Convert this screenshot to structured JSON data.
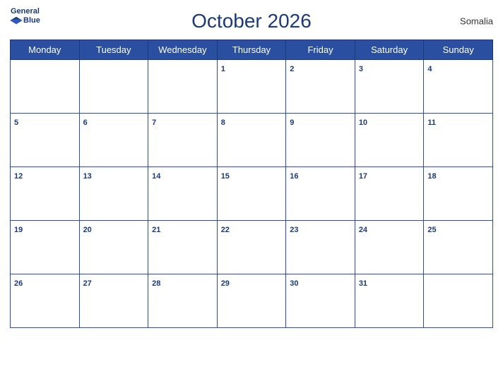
{
  "header": {
    "title": "October 2026",
    "country": "Somalia",
    "logo_general": "General",
    "logo_blue": "Blue"
  },
  "weekdays": [
    "Monday",
    "Tuesday",
    "Wednesday",
    "Thursday",
    "Friday",
    "Saturday",
    "Sunday"
  ],
  "weeks": [
    [
      null,
      null,
      null,
      1,
      2,
      3,
      4
    ],
    [
      5,
      6,
      7,
      8,
      9,
      10,
      11
    ],
    [
      12,
      13,
      14,
      15,
      16,
      17,
      18
    ],
    [
      19,
      20,
      21,
      22,
      23,
      24,
      25
    ],
    [
      26,
      27,
      28,
      29,
      30,
      31,
      null
    ]
  ]
}
